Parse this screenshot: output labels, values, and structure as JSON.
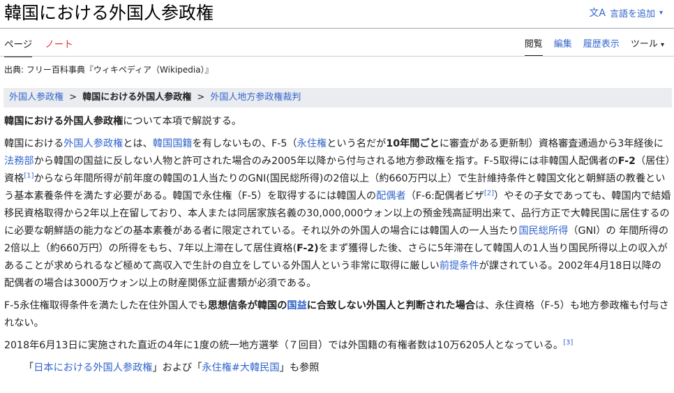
{
  "page": {
    "title": "韓国における外国人参政権",
    "lang_button": "言語を追加",
    "tabs_left": [
      "ページ",
      "ノート"
    ],
    "tabs_right": [
      "閲覧",
      "編集",
      "履歴表示",
      "ツール"
    ],
    "source": "出典: フリー百科事典『ウィキペディア（Wikipedia）』"
  },
  "breadcrumb": {
    "parent": "外国人参政権",
    "current": "韓国における外国人参政権",
    "child": "外国人地方参政権裁判",
    "sep": ">"
  },
  "intro": {
    "bold": "韓国における外国人参政権",
    "rest": "について本項で解説する。"
  },
  "p1": {
    "t1": "韓国における",
    "l1": "外国人参政権",
    "t2": "とは、",
    "l2": "韓国国籍",
    "t3": "を有しないもの、F-5（",
    "l3": "永住権",
    "t4": "という名だが",
    "b1": "10年間ごと",
    "t5": "に審査がある更新制）資格審査通過から3年経後に",
    "l4": "法務部",
    "t6": "から韓国の国益に反しない人物と許可された場合のみ2005年以降から付与される地方参政権を指す。F-5取得には非韓国人配偶者の",
    "b2": "F-2",
    "t7": "（居住）資格",
    "r1": "[1]",
    "t8": "からなら年間所得が前年度の韓国の1人当たりのGNI(国民総所得)の2倍以上（約660万円以上）で生計維持条件と韓国文化と朝鮮語の教養という基本素養条件を満たす必要がある。韓国で永住権（F-5）を取得するには韓国人の",
    "l5": "配偶者",
    "t9": "（F-6:配偶者ビザ",
    "r2": "[2]",
    "t10": "）やその子女であっても、韓国内で結婚移民資格取得から2年以上在留しており、本人または同居家族名義の30,000,000ウォン以上の預金残高証明出来て、品行方正で大韓民国に居住するのに必要な朝鮮語の能力などの基本素養がある者に限定されている。それ以外の外国人の場合には韓国人の一人当たり",
    "l6": "国民総所得",
    "t11": "（GNI）の 年間所得の2倍以上（約660万円）の所得をもち、7年以上滞在して居住資格(",
    "b3": "F-2)",
    "t12": "をまず獲得した後、さらに5年滞在して韓国人の1人当り国民所得以上の収入があることが求められるなど極めて高収入で生計の自立をしている外国人という非常に取得に厳しい",
    "l7": "前提条件",
    "t13": "が課されている。2002年4月18日以降の配偶者の場合は3000万ウォン以上の財産関係立証書類が必須である。"
  },
  "p2": {
    "t1": "F-5永住権取得条件を満たした在住外国人でも",
    "b1": "思想信条が韓国の",
    "l1": "国益",
    "b2": "に合致しない外国人と判断された場合",
    "t2": "は、永住資格（F-5）も地方参政権も付与されない。"
  },
  "p3": {
    "t1": "2018年6月13日に実施された直近の4年に1度の統一地方選挙（７回目）では外国籍の有権者数は10万6205人となっている。",
    "r1": "[3]"
  },
  "hatnote": {
    "q1": "「",
    "l1": "日本における外国人参政権",
    "t1": "」および「",
    "l2": "永住権#大韓民国",
    "t2": "」も参照"
  },
  "colors": {
    "link": "#3366cc",
    "new_link": "#dd3333",
    "crumb_bg": "#eaecf0"
  },
  "icons": [
    "translate-icon",
    "chevron-down-icon"
  ]
}
